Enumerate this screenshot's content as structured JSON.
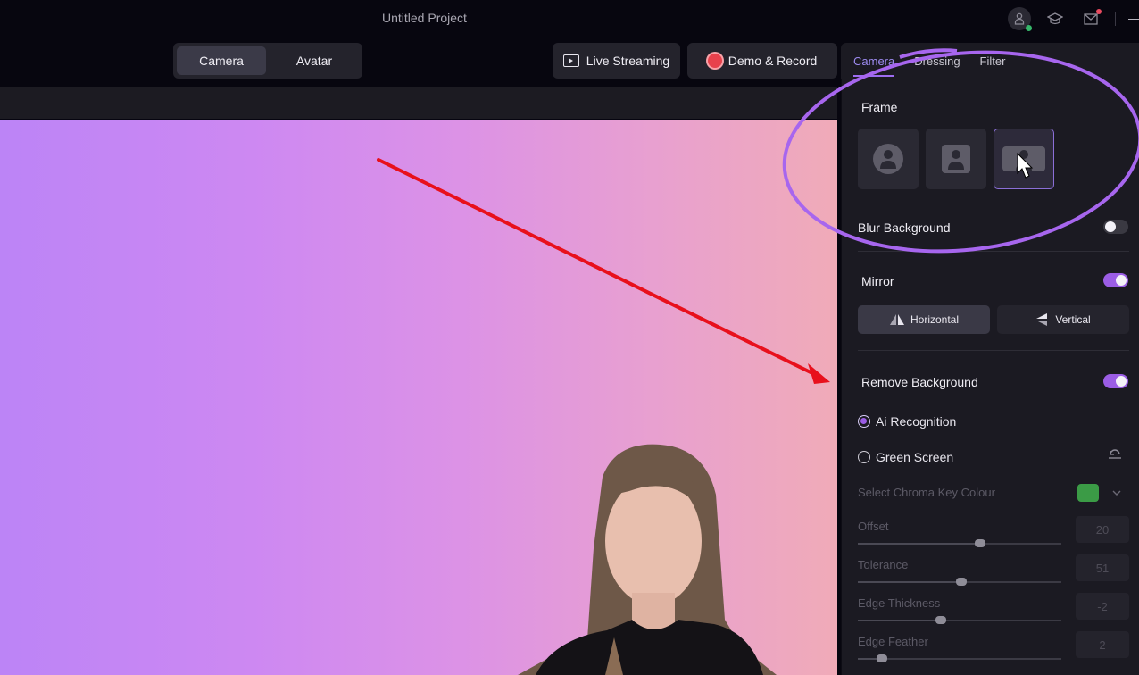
{
  "titlebar": {
    "title": "Untitled Project",
    "icons": [
      "user-icon",
      "graduation-cap-icon",
      "mail-icon",
      "minimize-icon"
    ]
  },
  "toolbar": {
    "mode_tabs": [
      {
        "label": "Camera",
        "active": true
      },
      {
        "label": "Avatar",
        "active": false
      }
    ],
    "live_streaming_label": "Live Streaming",
    "demo_record_label": "Demo & Record"
  },
  "panel": {
    "tabs": [
      {
        "label": "Camera",
        "active": true
      },
      {
        "label": "Dressing",
        "active": false
      },
      {
        "label": "Filter",
        "active": false
      }
    ],
    "frame": {
      "label": "Frame",
      "options": [
        "circle-frame",
        "square-frame",
        "rectangle-frame"
      ],
      "selected_index": 2
    },
    "blur_background": {
      "label": "Blur Background",
      "enabled": false
    },
    "mirror": {
      "label": "Mirror",
      "enabled": true,
      "options": [
        {
          "label": "Horizontal",
          "active": true
        },
        {
          "label": "Vertical",
          "active": false
        }
      ]
    },
    "remove_background": {
      "label": "Remove Background",
      "enabled": true,
      "modes": [
        {
          "label": "Ai Recognition",
          "checked": true
        },
        {
          "label": "Green Screen",
          "checked": false
        }
      ],
      "chroma_key_label": "Select Chroma Key Colour",
      "chroma_key_color": "#3b9b46",
      "sliders": [
        {
          "label": "Offset",
          "value": "20",
          "fraction": 0.6
        },
        {
          "label": "Tolerance",
          "value": "51",
          "fraction": 0.51
        },
        {
          "label": "Edge Thickness",
          "value": "-2",
          "fraction": 0.41
        },
        {
          "label": "Edge Feather",
          "value": "2",
          "fraction": 0.12
        }
      ]
    }
  },
  "colors": {
    "accent": "#9b5de5",
    "annotation_circle": "#a766ee",
    "annotation_arrow": "#e8101c"
  }
}
